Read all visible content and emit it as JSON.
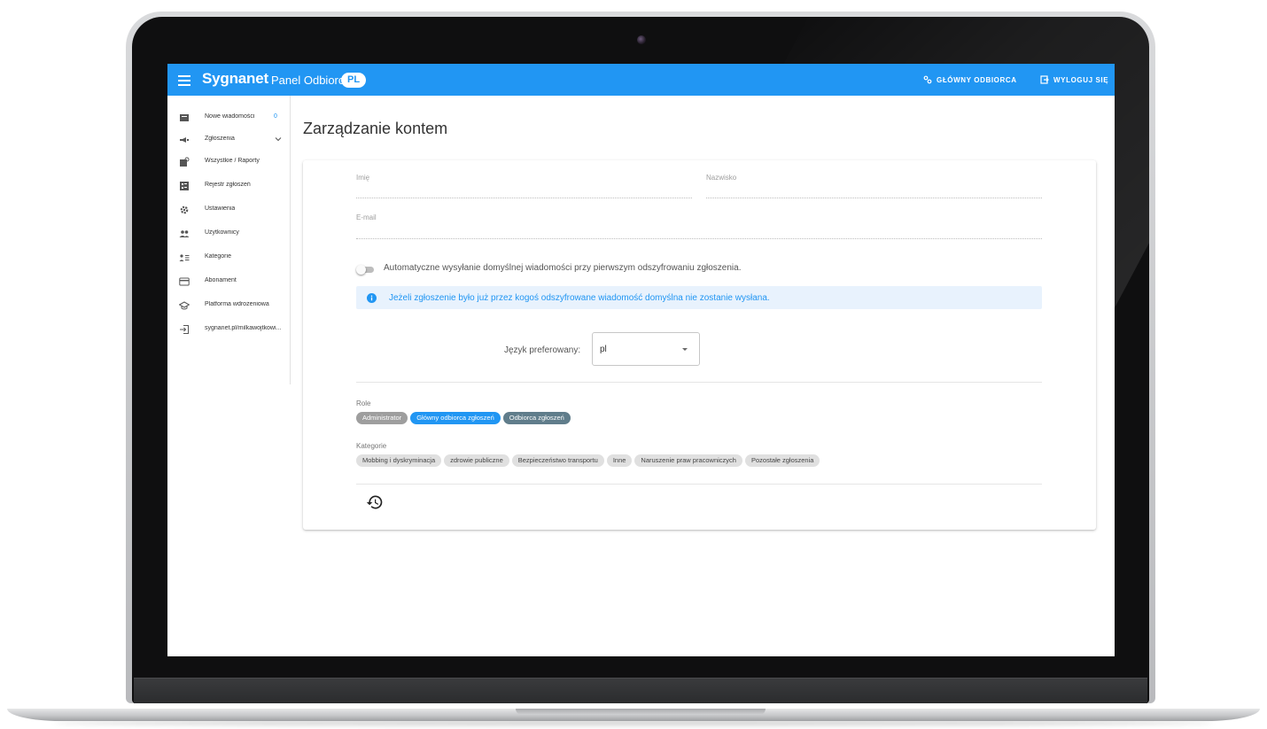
{
  "app": {
    "logo": "Sygnanet",
    "panel_title": "Panel Odbiorcy",
    "language_badge": "PL"
  },
  "header": {
    "main_recipient_label": "GŁÓWNY ODBIORCA",
    "logout_label": "WYLOGUJ SIĘ"
  },
  "sidebar": {
    "items": [
      {
        "label": "Nowe wiadomości",
        "icon": "inbox-icon",
        "badge": "0"
      },
      {
        "label": "Zgłoszenia",
        "icon": "megaphone-icon",
        "expandable": true
      },
      {
        "label": "Wszystkie / Raporty",
        "icon": "reports-icon"
      },
      {
        "label": "Rejestr zgłoszeń",
        "icon": "register-icon"
      },
      {
        "label": "Ustawienia",
        "icon": "gear-icon"
      },
      {
        "label": "Użytkownicy",
        "icon": "users-icon"
      },
      {
        "label": "Kategorie",
        "icon": "categories-icon"
      },
      {
        "label": "Abonament",
        "icon": "credit-card-icon"
      },
      {
        "label": "Platforma wdrożeniowa",
        "icon": "graduation-cap-icon"
      },
      {
        "label": "sygnanet.pl/milkawojtkowi...",
        "icon": "login-link-icon"
      }
    ]
  },
  "main": {
    "page_title": "Zarządzanie kontem",
    "form": {
      "first_name_label": "Imię",
      "first_name_value": "",
      "last_name_label": "Nazwisko",
      "last_name_value": "",
      "email_label": "E-mail",
      "email_value": "",
      "auto_message_toggle_label": "Automatyczne wysyłanie domyślnej wiadomości przy pierwszym odszyfrowaniu zgłoszenia.",
      "auto_message_enabled": false,
      "info_text": "Jeżeli zgłoszenie było już przez kogoś odszyfrowane wiadomość domyślna nie zostanie wysłana.",
      "preferred_language_label": "Język preferowany:",
      "preferred_language_value": "pl"
    },
    "roles": {
      "label": "Role",
      "items": [
        {
          "label": "Administrator",
          "style": "grey"
        },
        {
          "label": "Główny odbiorca zgłoszeń",
          "style": "blue"
        },
        {
          "label": "Odbiorca zgłoszeń",
          "style": "dark"
        }
      ]
    },
    "categories": {
      "label": "Kategorie",
      "items": [
        "Mobbing i dyskryminacja",
        "zdrowie publiczne",
        "Bezpieczeństwo transportu",
        "Inne",
        "Naruszenie praw pracowniczych",
        "Pozostałe zgłoszenia"
      ]
    }
  },
  "colors": {
    "primary": "#2196f3",
    "info_bg": "#e8f2fd",
    "chip_grey": "#9e9e9e",
    "chip_dark": "#607d8b",
    "chip_light": "#e0e0e0"
  }
}
